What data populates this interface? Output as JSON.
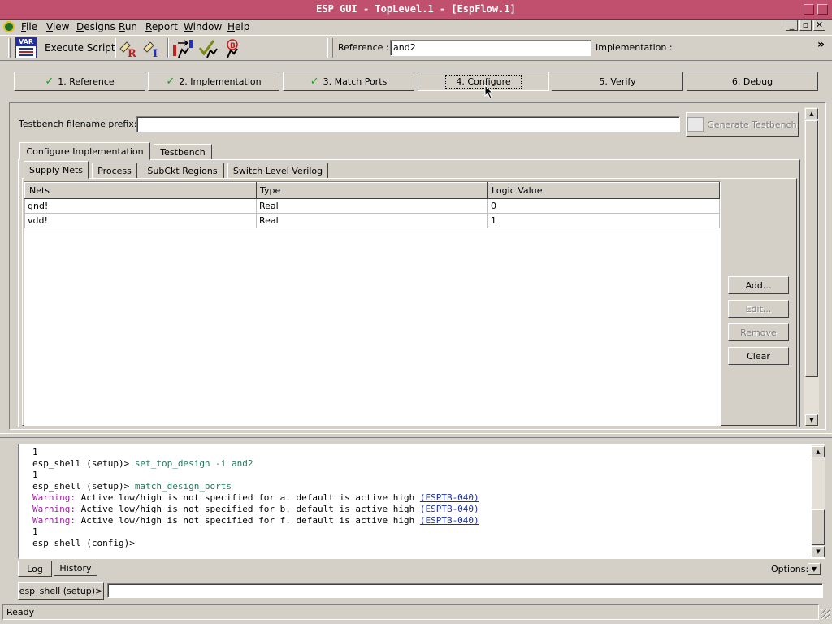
{
  "window": {
    "title": "ESP GUI - TopLevel.1 - [EspFlow.1]"
  },
  "menu": [
    {
      "label": "File",
      "key": "F"
    },
    {
      "label": "View",
      "key": "V"
    },
    {
      "label": "Designs",
      "key": "D"
    },
    {
      "label": "Run",
      "key": "R"
    },
    {
      "label": "Report",
      "key": "R"
    },
    {
      "label": "Window",
      "key": "W"
    },
    {
      "label": "Help",
      "key": "H"
    }
  ],
  "toolbar": {
    "var_icon_text": "VAR",
    "execute_script_label": "Execute Script",
    "reference_label": "Reference :",
    "reference_value": "and2",
    "implementation_label": "Implementation :",
    "overflow": "»"
  },
  "steps": [
    {
      "label": "1. Reference",
      "done": true
    },
    {
      "label": "2. Implementation",
      "done": true
    },
    {
      "label": "3. Match Ports",
      "done": true
    },
    {
      "label": "4. Configure",
      "done": false
    },
    {
      "label": "5. Verify",
      "done": false
    },
    {
      "label": "6. Debug",
      "done": false
    }
  ],
  "configure": {
    "prefix_label": "Testbench filename prefix:",
    "prefix_value": "",
    "generate_button": "Generate Testbench",
    "outer_tabs": [
      "Configure Implementation",
      "Testbench"
    ],
    "inner_tabs": [
      "Supply Nets",
      "Process",
      "SubCkt Regions",
      "Switch Level Verilog"
    ],
    "table": {
      "columns": [
        "Nets",
        "Type",
        "Logic Value"
      ],
      "rows": [
        [
          "gnd!",
          "Real",
          "0"
        ],
        [
          "vdd!",
          "Real",
          "1"
        ]
      ]
    },
    "buttons": {
      "add": "Add...",
      "edit": "Edit...",
      "remove": "Remove",
      "clear": "Clear"
    }
  },
  "log": {
    "lines": [
      {
        "prompt": "1",
        "cmd": ""
      },
      {
        "prompt": "esp_shell (setup)> ",
        "cmd": "set_top_design -i and2"
      },
      {
        "prompt": "1",
        "cmd": ""
      },
      {
        "prompt": "esp_shell (setup)> ",
        "cmd": "match_design_ports"
      }
    ],
    "warnings": [
      {
        "label": "Warning:",
        "text": " Active low/high is not specified for a. default is active high ",
        "code": "(ESPTB-040)"
      },
      {
        "label": "Warning:",
        "text": " Active low/high is not specified for b. default is active high ",
        "code": "(ESPTB-040)"
      },
      {
        "label": "Warning:",
        "text": " Active low/high is not specified for f. default is active high ",
        "code": "(ESPTB-040)"
      }
    ],
    "tail": [
      "1",
      "esp_shell (config)>"
    ],
    "tabs": [
      "Log",
      "History"
    ],
    "options_label": "Options:",
    "shell_prompt": "esp_shell (setup)>",
    "shell_input": ""
  },
  "status": {
    "text": "Ready"
  }
}
